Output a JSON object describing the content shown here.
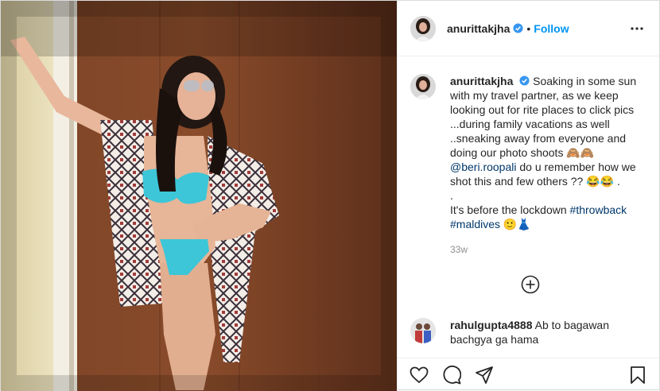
{
  "post": {
    "username": "anurittakjha",
    "dot": "•",
    "follow_label": "Follow",
    "caption": {
      "username": "anurittakjha",
      "lines": [
        "Soaking in some sun",
        "with my travel partner, as we keep",
        "looking out for rite places to click pics",
        "...during family vacations as well",
        "..sneaking away from everyone and",
        "doing our photo shoots 🙈🙈"
      ],
      "mention": "@beri.roopali",
      "mention_rest": " do u remember how we",
      "line_after_mention": "shot this and few others ?? 😂😂 .",
      "dot_line": ".",
      "lockdown_text": "It's before the lockdown ",
      "hashtag1": "#throwback",
      "hashtag2": "#maldives",
      "end_emoji": " 🙂👗"
    },
    "time_ago": "33w",
    "comment": {
      "username": "rahulgupta4888",
      "text": " Ab to bagawan bachgya ga hama"
    }
  },
  "icons": {
    "verified": "verified-badge-icon",
    "more": "more-options-icon",
    "load": "load-more-comments-icon",
    "like": "heart-icon",
    "comment": "comment-icon",
    "share": "share-icon",
    "save": "bookmark-icon"
  },
  "colors": {
    "accent": "#0095f6",
    "link": "#00376b",
    "meta": "#8e8e8e",
    "border": "#dbdbdb"
  }
}
